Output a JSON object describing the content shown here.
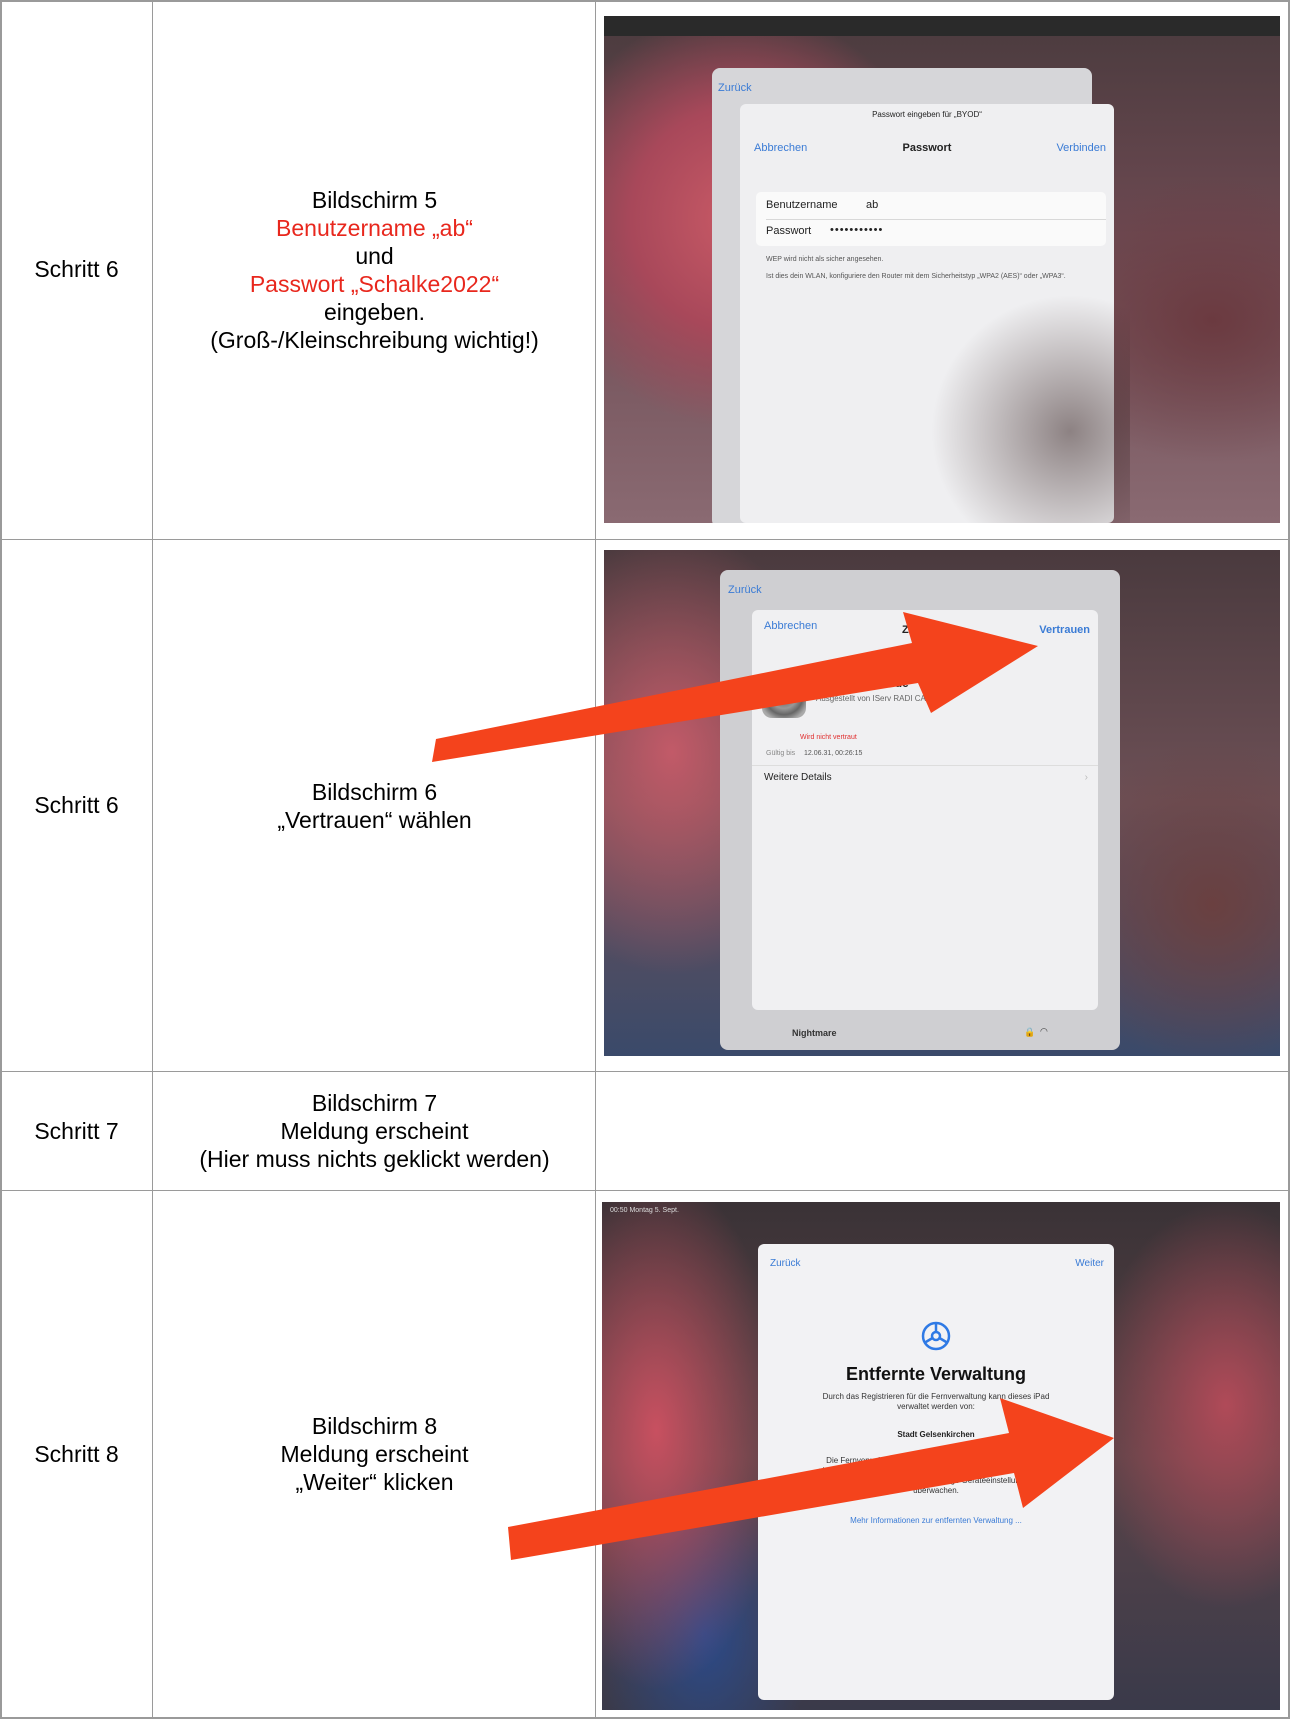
{
  "rows": [
    {
      "step": "Schritt 6",
      "desc": {
        "line1": "Bildschirm 5",
        "line2": "Benutzername „ab“",
        "line3": "und",
        "line4": "Passwort „Schalke2022“",
        "line5": "eingeben.",
        "line6": "(Groß-/Kleinschreibung wichtig!)"
      },
      "screen": {
        "back": "Zurück",
        "prompt": "Passwort eingeben für „BYOD“",
        "cancel": "Abbrechen",
        "title": "Passwort",
        "connect": "Verbinden",
        "user_label": "Benutzername",
        "user_value": "ab",
        "pass_label": "Passwort",
        "pass_value": "•••••••••••",
        "note1": "WEP wird nicht als sicher angesehen.",
        "note2": "Ist dies dein WLAN, konfiguriere den Router mit dem Sicherheitstyp „WPA2 (AES)“ oder „WPA3“."
      }
    },
    {
      "step": "Schritt 6",
      "desc": {
        "line1": "Bildschirm 6",
        "line2": "„Vertrauen“ wählen"
      },
      "screen": {
        "back": "Zurück",
        "cancel": "Abbrechen",
        "title": "Zert",
        "trust": "Vertrauen",
        "cert_name": "georgstrasse.de",
        "issued": "Ausgestellt von IServ RADI   CA X1",
        "not_trusted": "Wird nicht vertraut",
        "valid_label": "Gültig bis",
        "valid_value": "12.06.31, 00:26:15",
        "details": "Weitere Details",
        "network": "Nightmare"
      }
    },
    {
      "step": "Schritt 7",
      "desc": {
        "line1": "Bildschirm 7",
        "line2": "Meldung erscheint",
        "line3": "(Hier muss nichts geklickt werden)"
      }
    },
    {
      "step": "Schritt 8",
      "desc": {
        "line1": "Bildschirm 8",
        "line2": "Meldung erscheint",
        "line3": "„Weiter“ klicken"
      },
      "screen": {
        "status": "00:50  Montag 5. Sept.",
        "back": "Zurück",
        "next": "Weiter",
        "heading": "Entfernte Verwaltung",
        "intro": "Durch das Registrieren für die Fernverwaltung kann dieses iPad verwaltet werden von:",
        "org": "Stadt Gelsenkirchen",
        "body": "Die Fernverwaltung umfasst die Möglichkeit, die Funktionalität einzuschränken, Apps zu installieren, Daten-Backups zu verwalten sowie den Internetverkehr und einige Geräteeinstellungen zu überwachen.",
        "link": "Mehr Informationen zur entfernten Verwaltung ..."
      }
    }
  ],
  "colors": {
    "highlight": "#e8271d",
    "arrow": "#f4431c",
    "ios_blue": "#3a7bd5",
    "grid": "#9a9a9a"
  }
}
